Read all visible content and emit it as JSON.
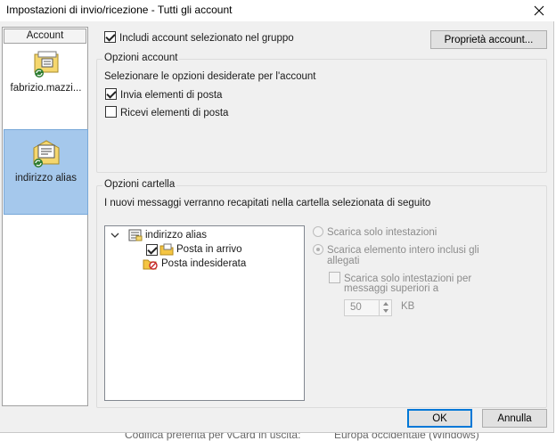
{
  "window": {
    "title": "Impostazioni di invio/ricezione - Tutti gli account"
  },
  "sidebar": {
    "header": "Account",
    "items": [
      {
        "label": "fabrizio.mazzi...",
        "icon": "mail-account-icon",
        "selected": false
      },
      {
        "label": "indirizzo alias",
        "icon": "alias-account-icon",
        "selected": true
      }
    ]
  },
  "top": {
    "include_label": "Includi account selezionato nel gruppo",
    "include_checked": true,
    "properties_button": "Proprietà account..."
  },
  "account_options": {
    "title": "Opzioni account",
    "description": "Selezionare le opzioni desiderate per l'account",
    "send_label": "Invia elementi di posta",
    "send_checked": true,
    "receive_label": "Ricevi elementi di posta",
    "receive_checked": false
  },
  "folder_options": {
    "title": "Opzioni cartella",
    "description": "I nuovi messaggi verranno recapitati nella cartella selezionata di seguito",
    "tree": [
      {
        "label": "indirizzo alias",
        "icon": "mailbox-icon",
        "expanded": true
      },
      {
        "label": "Posta in arrivo",
        "icon": "inbox-folder-icon",
        "checked": true
      },
      {
        "label": "Posta indesiderata",
        "icon": "junk-folder-icon"
      }
    ],
    "radio_headers_only": "Scarica solo intestazioni",
    "radio_full_line1": "Scarica elemento intero inclusi gli",
    "radio_full_line2": "allegati",
    "limit_line1": "Scarica solo intestazioni per",
    "limit_line2": "messaggi superiori a",
    "limit_value": "50",
    "limit_unit": "KB"
  },
  "buttons": {
    "ok": "OK",
    "cancel": "Annulla"
  },
  "background_strip": {
    "left_text": "Codifica preferita per vCard in uscita:",
    "right_text": "Europa occidentale (Windows)"
  },
  "colors": {
    "selection": "#a5c8ec",
    "dialog_bg": "#f0f0f0",
    "default_button_border": "#0078d7"
  }
}
